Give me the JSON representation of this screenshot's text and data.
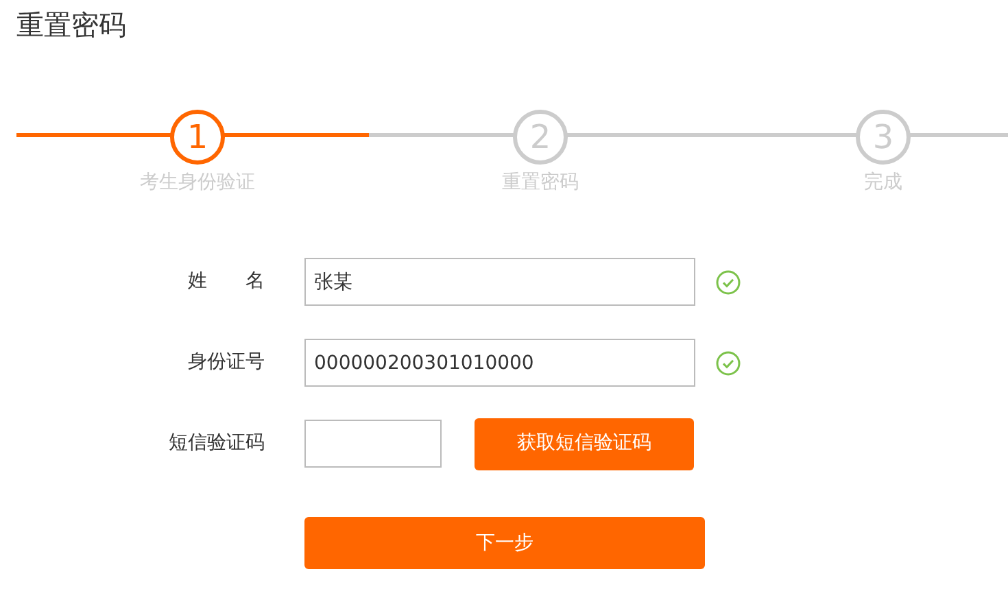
{
  "title": "重置密码",
  "steps": [
    {
      "number": "1",
      "label": "考生身份验证",
      "selected": true
    },
    {
      "number": "2",
      "label": "重置密码",
      "selected": false
    },
    {
      "number": "3",
      "label": "完成",
      "selected": false
    }
  ],
  "fields": [
    {
      "kind": "text",
      "label": "姓　　名",
      "value": "张某",
      "valid": true
    },
    {
      "kind": "text",
      "label": "身份证号",
      "value": "000000200301010000",
      "valid": true
    },
    {
      "kind": "code",
      "label": "短信验证码",
      "button": "获取短信验证码"
    }
  ],
  "submit": "下一步"
}
